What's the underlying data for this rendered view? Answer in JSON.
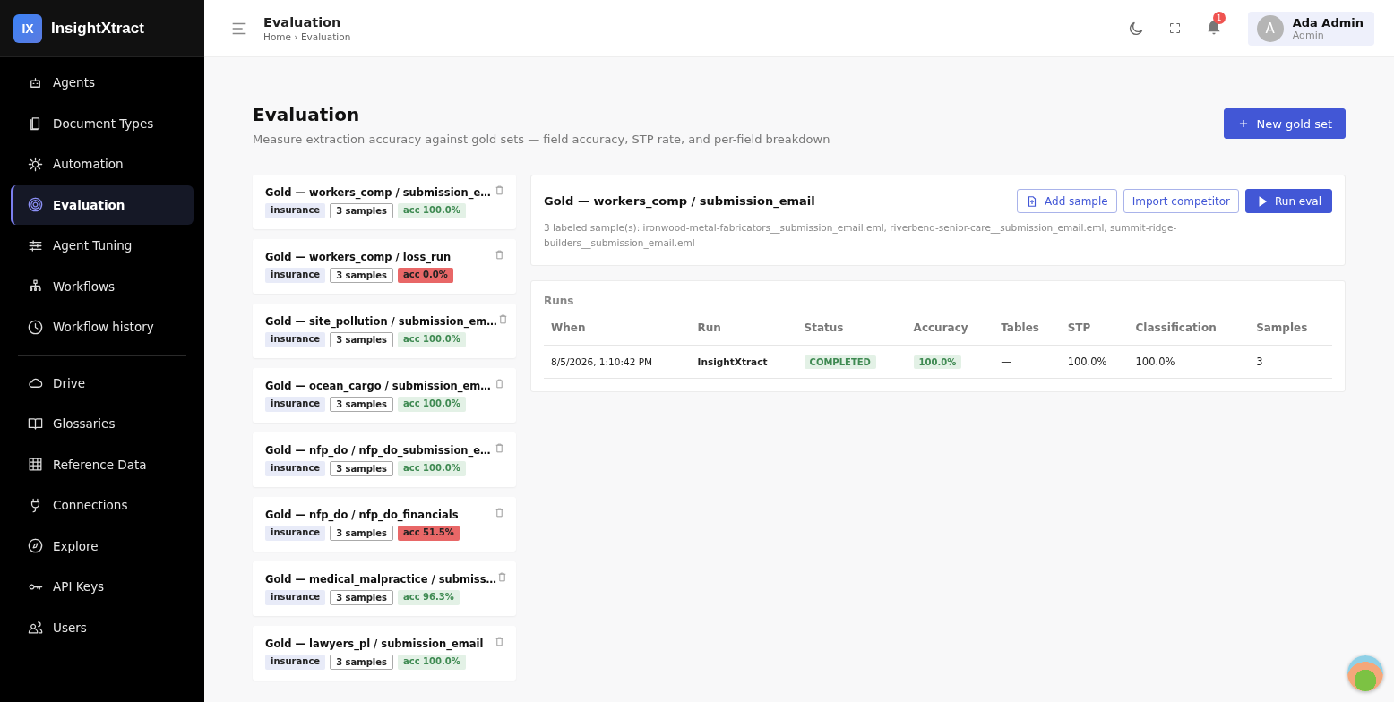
{
  "brand": {
    "logo": "IX",
    "name": "InsightXtract"
  },
  "sidebar": {
    "groups": [
      {
        "items": [
          {
            "label": "Agents",
            "selected": false
          },
          {
            "label": "Document Types",
            "selected": false
          },
          {
            "label": "Automation",
            "selected": false
          },
          {
            "label": "Evaluation",
            "selected": true
          },
          {
            "label": "Agent Tuning",
            "selected": false
          },
          {
            "label": "Workflows",
            "selected": false
          },
          {
            "label": "Workflow history",
            "selected": false
          }
        ]
      },
      {
        "items": [
          {
            "label": "Drive",
            "selected": false
          },
          {
            "label": "Glossaries",
            "selected": false
          },
          {
            "label": "Reference Data",
            "selected": false
          },
          {
            "label": "Connections",
            "selected": false
          },
          {
            "label": "Explore",
            "selected": false
          },
          {
            "label": "API Keys",
            "selected": false
          },
          {
            "label": "Users",
            "selected": false
          }
        ]
      }
    ]
  },
  "topbar": {
    "title": "Evaluation",
    "breadcrumb": "Home › Evaluation",
    "notifications": "1",
    "user": {
      "initial": "A",
      "name": "Ada Admin",
      "role": "Admin"
    }
  },
  "page": {
    "title": "Evaluation",
    "subtitle": "Measure extraction accuracy against gold sets — field accuracy, STP rate, and per-field breakdown",
    "new_button": "New gold set"
  },
  "gold_sets": [
    {
      "title": "Gold — workers_comp / submission_e…",
      "domain": "insurance",
      "samples": "3 samples",
      "accuracy": "acc 100.0%",
      "failing": false
    },
    {
      "title": "Gold — workers_comp / loss_run",
      "domain": "insurance",
      "samples": "3 samples",
      "accuracy": "acc 0.0%",
      "failing": true
    },
    {
      "title": "Gold — site_pollution / submission_em…",
      "domain": "insurance",
      "samples": "3 samples",
      "accuracy": "acc 100.0%",
      "failing": false
    },
    {
      "title": "Gold — ocean_cargo / submission_em…",
      "domain": "insurance",
      "samples": "3 samples",
      "accuracy": "acc 100.0%",
      "failing": false
    },
    {
      "title": "Gold — nfp_do / nfp_do_submission_e…",
      "domain": "insurance",
      "samples": "3 samples",
      "accuracy": "acc 100.0%",
      "failing": false
    },
    {
      "title": "Gold — nfp_do / nfp_do_financials",
      "domain": "insurance",
      "samples": "3 samples",
      "accuracy": "acc 51.5%",
      "failing": true
    },
    {
      "title": "Gold — medical_malpractice / submiss…",
      "domain": "insurance",
      "samples": "3 samples",
      "accuracy": "acc 96.3%",
      "failing": false
    },
    {
      "title": "Gold — lawyers_pl / submission_email",
      "domain": "insurance",
      "samples": "3 samples",
      "accuracy": "acc 100.0%",
      "failing": false
    }
  ],
  "detail": {
    "title": "Gold — workers_comp / submission_email",
    "description": "3 labeled sample(s): ironwood-metal-fabricators__submission_email.eml, riverbend-senior-care__submission_email.eml, summit-ridge-builders__submission_email.eml",
    "buttons": {
      "add_sample": "Add sample",
      "import": "Import competitor",
      "run": "Run eval"
    }
  },
  "runs": {
    "title": "Runs",
    "columns": [
      "When",
      "Run",
      "Status",
      "Accuracy",
      "Tables",
      "STP",
      "Classification",
      "Samples"
    ],
    "rows": [
      {
        "when": "8/5/2026, 1:10:42 PM",
        "run": "InsightXtract",
        "status": "COMPLETED",
        "accuracy": "100.0%",
        "tables": "—",
        "stp": "100.0%",
        "classification": "100.0%",
        "samples": "3"
      }
    ]
  }
}
